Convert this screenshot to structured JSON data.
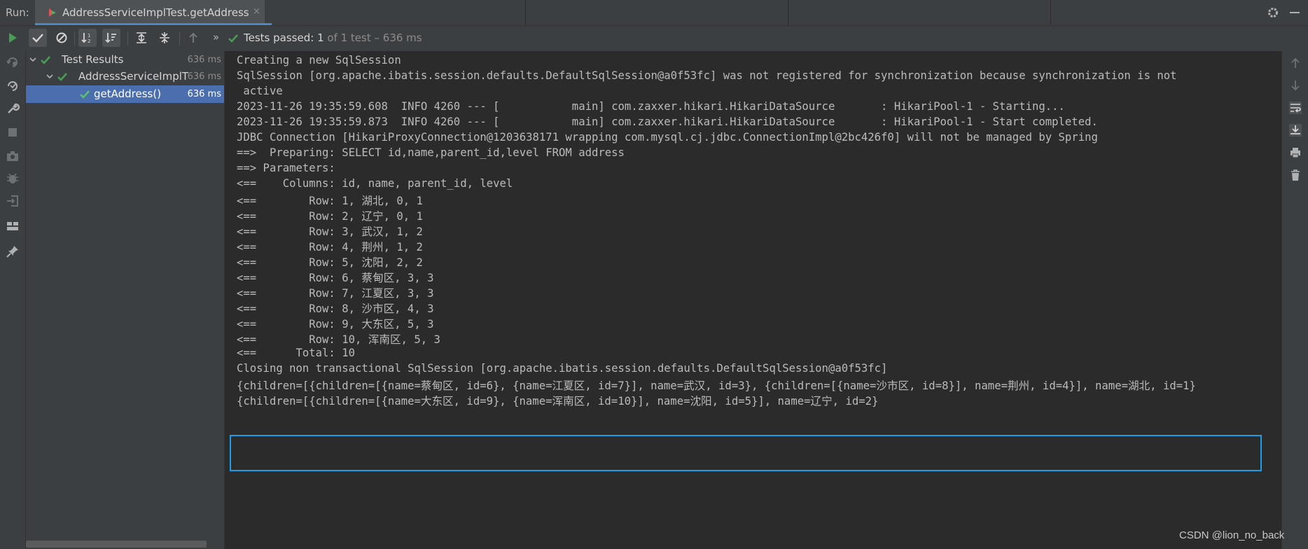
{
  "run_panel": {
    "label": "Run:",
    "tab": {
      "title": "AddressServiceImplTest.getAddress",
      "close": "×"
    }
  },
  "toolbar": {
    "status_prefix": "Tests passed:",
    "status_count": "1",
    "status_rest": "of 1 test – 636 ms",
    "overflow": "»"
  },
  "tree": {
    "items": [
      {
        "label": "Test Results",
        "duration": "636 ms"
      },
      {
        "label": "AddressServiceImplT",
        "duration": "636 ms"
      },
      {
        "label": "getAddress()",
        "duration": "636 ms"
      }
    ]
  },
  "console": {
    "lines": [
      "Creating a new SqlSession",
      "SqlSession [org.apache.ibatis.session.defaults.DefaultSqlSession@a0f53fc] was not registered for synchronization because synchronization is not",
      " active",
      "2023-11-26 19:35:59.608  INFO 4260 --- [           main] com.zaxxer.hikari.HikariDataSource       : HikariPool-1 - Starting...",
      "2023-11-26 19:35:59.873  INFO 4260 --- [           main] com.zaxxer.hikari.HikariDataSource       : HikariPool-1 - Start completed.",
      "JDBC Connection [HikariProxyConnection@1203638171 wrapping com.mysql.cj.jdbc.ConnectionImpl@2bc426f0] will not be managed by Spring",
      "==>  Preparing: SELECT id,name,parent_id,level FROM address",
      "==> Parameters: ",
      "<==    Columns: id, name, parent_id, level",
      "<==        Row: 1, 湖北, 0, 1",
      "<==        Row: 2, 辽宁, 0, 1",
      "<==        Row: 3, 武汉, 1, 2",
      "<==        Row: 4, 荆州, 1, 2",
      "<==        Row: 5, 沈阳, 2, 2",
      "<==        Row: 6, 蔡甸区, 3, 3",
      "<==        Row: 7, 江夏区, 3, 3",
      "<==        Row: 8, 沙市区, 4, 3",
      "<==        Row: 9, 大东区, 5, 3",
      "<==        Row: 10, 浑南区, 5, 3",
      "<==      Total: 10",
      "Closing non transactional SqlSession [org.apache.ibatis.session.defaults.DefaultSqlSession@a0f53fc]",
      "{children=[{children=[{name=蔡甸区, id=6}, {name=江夏区, id=7}], name=武汉, id=3}, {children=[{name=沙市区, id=8}], name=荆州, id=4}], name=湖北, id=1}",
      "{children=[{children=[{name=大东区, id=9}, {name=浑南区, id=10}], name=沈阳, id=5}], name=辽宁, id=2}"
    ]
  },
  "watermark": "CSDN @lion_no_back",
  "colors": {
    "accent": "#4a88c7",
    "pass_green": "#499c54",
    "selection": "#4b6eaf",
    "highlight_border": "#1e9ee6"
  }
}
